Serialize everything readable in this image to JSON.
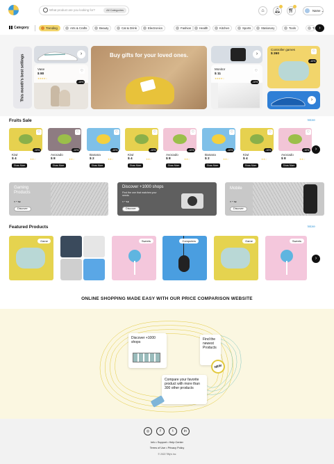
{
  "header": {
    "search_placeholder": "What product are you looking for?",
    "category_select": "All Categories",
    "user_name": "Name"
  },
  "categories": {
    "label": "Category",
    "items": [
      "Trending",
      "Arts & Crafts",
      "Beauty",
      "Cat & Drink",
      "Electronics",
      "Fashion",
      "Health",
      "Kitchen",
      "Sports",
      "Stationary",
      "Tools",
      "Toys"
    ]
  },
  "best": {
    "label": "This month's best sellings",
    "promo": "Buy gifts for your loved ones.",
    "products": [
      {
        "name": "Vase",
        "price": "$ 80",
        "discount": "-15%"
      },
      {
        "name": "Monitor",
        "price": "$ 11",
        "discount": "-10%"
      },
      {
        "name": "Controller games",
        "price": "$ 260",
        "discount": "-10%"
      }
    ]
  },
  "fruits": {
    "title": "Fruits Sale",
    "more": "More",
    "button": "Show More",
    "items": [
      {
        "name": "Kiwi",
        "price": "$ 4",
        "discount": "-10%"
      },
      {
        "name": "Avocado",
        "price": "$ 8",
        "discount": "-10%"
      },
      {
        "name": "Banana",
        "price": "$ 2",
        "discount": "-10%"
      },
      {
        "name": "Kiwi",
        "price": "$ 4",
        "discount": "-10%"
      },
      {
        "name": "Avocado",
        "price": "$ 8",
        "discount": "-10%"
      },
      {
        "name": "Banana",
        "price": "$ 2",
        "discount": "-10%"
      },
      {
        "name": "Kiwi",
        "price": "$ 4",
        "discount": "-10%"
      },
      {
        "name": "Avocado",
        "price": "$ 8",
        "discount": "-10%"
      }
    ]
  },
  "banners": [
    {
      "title": "Gaming Products",
      "subtitle": "",
      "button": "Discover"
    },
    {
      "title": "Discover +1000 shops",
      "subtitle": "Find the one that matches your needs",
      "button": "Discover"
    },
    {
      "title": "Mobile",
      "subtitle": "",
      "button": "Discover"
    }
  ],
  "featured": {
    "title": "Featured Products",
    "more": "More",
    "tags": [
      "Game",
      "",
      "Sweets",
      "Computers",
      "Game",
      "Sweets"
    ]
  },
  "tagline": "ONLINE SHOPPING MADE EASY WITH OUR PRICE COMPARISON WEBSITE",
  "hero_notes": {
    "shops": "Discover +1000 shops",
    "newest": "Find the newest Products",
    "new_badge": "NEW",
    "compare": "Compare your favorite product with more than 300 other products"
  },
  "footer": {
    "links1": "Info • Support • Help Center",
    "links2": "Terms of Use • Privacy Policy",
    "copyright": "© 2022 Tiffy’s Inc"
  },
  "colors": {
    "accent_yellow": "#f2d56b",
    "accent_blue": "#3a9ad9",
    "dark": "#111111"
  }
}
